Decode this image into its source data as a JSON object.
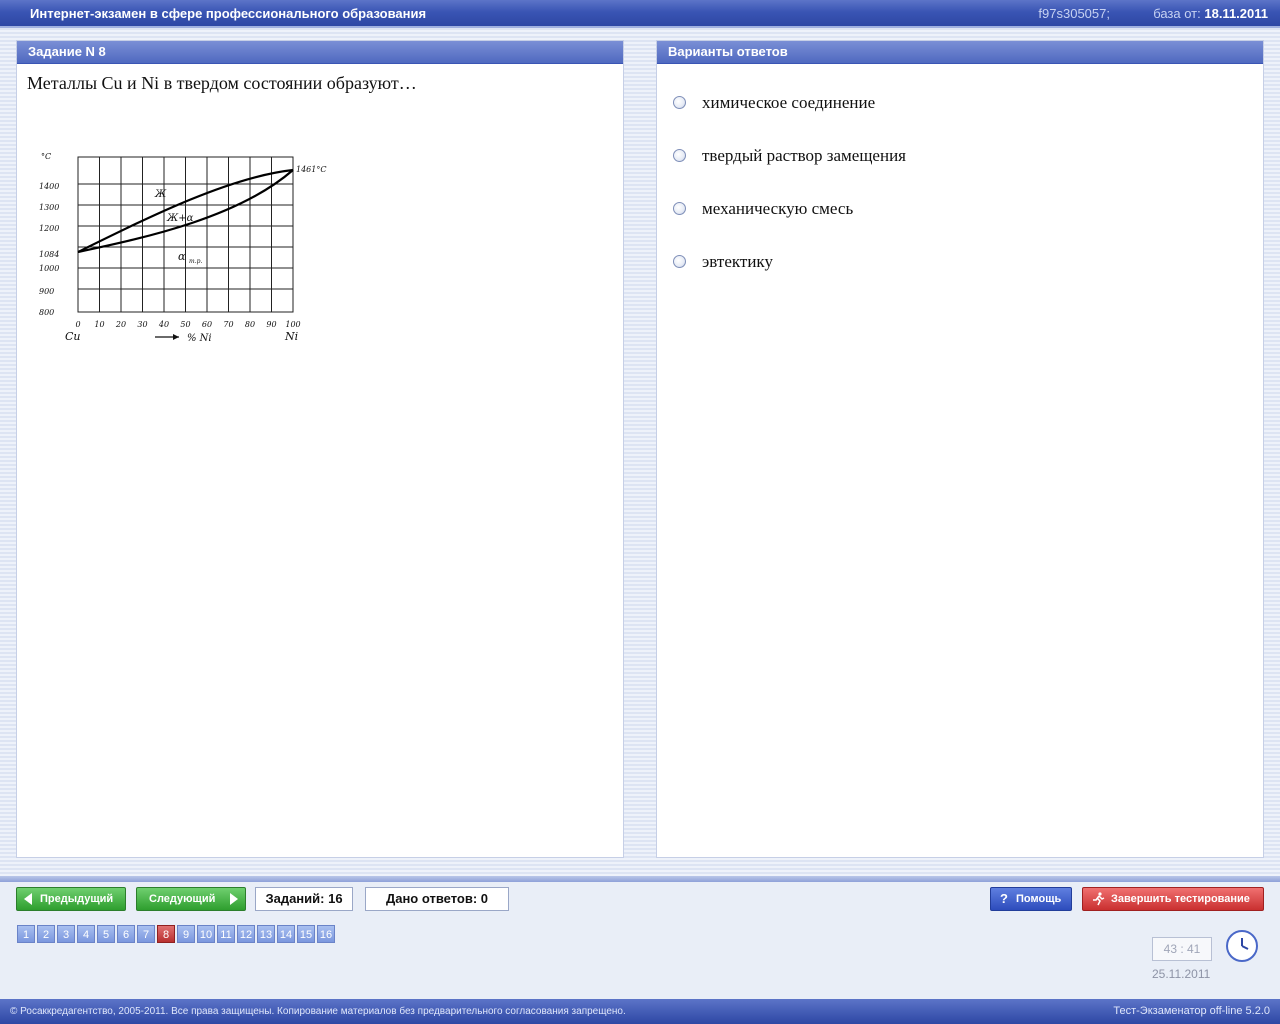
{
  "titlebar": {
    "title": "Интернет-экзамен в сфере профессионального образования",
    "session_id": "f97s305057;",
    "base_label": "база от:",
    "base_date": "18.11.2011"
  },
  "question_panel": {
    "header": "Задание N 8",
    "text": "Металлы Cu и Ni в твердом состоянии образуют…",
    "diagram": {
      "y_unit": "°C",
      "y_ticks": [
        "1400",
        "1300",
        "1200",
        "1084",
        "1000",
        "900",
        "800"
      ],
      "x_ticks": [
        "0",
        "10",
        "20",
        "30",
        "40",
        "50",
        "60",
        "70",
        "80",
        "90",
        "100"
      ],
      "left_element": "Cu",
      "right_element": "Ni",
      "x_label": "% Ni",
      "top_label": "1461°C",
      "region_liquid": "Ж",
      "region_two_phase": "Ж+α",
      "region_solid": "α",
      "region_solid_sub": "т.р."
    }
  },
  "answers_panel": {
    "header": "Варианты ответов",
    "options": [
      {
        "label": "химическое соединение"
      },
      {
        "label": "твердый раствор замещения"
      },
      {
        "label": "механическую смесь"
      },
      {
        "label": "эвтектику"
      }
    ]
  },
  "controls": {
    "prev_label": "Предыдущий",
    "next_label": "Следующий",
    "tasks_count": "Заданий: 16",
    "answers_given": "Дано ответов: 0",
    "help_label": "Помощь",
    "finish_label": "Завершить тестирование"
  },
  "pager": {
    "pages": [
      "1",
      "2",
      "3",
      "4",
      "5",
      "6",
      "7",
      "8",
      "9",
      "10",
      "11",
      "12",
      "13",
      "14",
      "15",
      "16"
    ],
    "current": "8",
    "active_color": "#c03a3a"
  },
  "timer": {
    "time": "43 : 41",
    "date": "25.11.2011"
  },
  "footer": {
    "copyright": "© Росаккредагентство, 2005-2011. Все права защищены. Копирование материалов без предварительного согласования запрещено.",
    "version": "Тест-Экзаменатор off-line 5.2.0"
  },
  "colors": {
    "header_blue": "#3a55b4",
    "button_green": "#2e9e2e",
    "button_blue": "#2d4cbc",
    "button_red": "#c93030"
  }
}
